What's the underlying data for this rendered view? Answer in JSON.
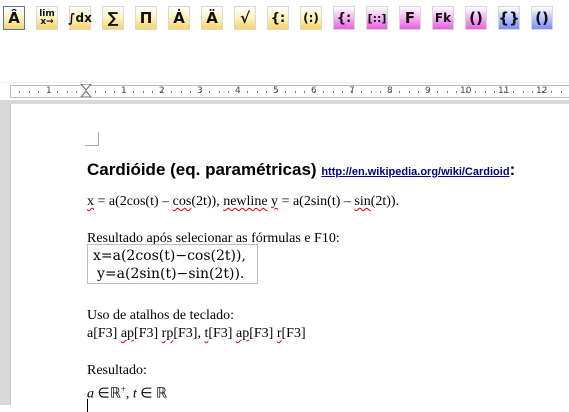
{
  "toolbar": {
    "buttons": [
      {
        "name": "symbol-a-hat-button",
        "glyph": "Â",
        "style": "yellow",
        "active": true
      },
      {
        "name": "limits-button",
        "glyph": "lim x→",
        "style": "yellow"
      },
      {
        "name": "integral-button",
        "glyph": "∫dx",
        "style": "yellow"
      },
      {
        "name": "sum-button",
        "glyph": "∑",
        "style": "yellow"
      },
      {
        "name": "product-button",
        "glyph": "Π",
        "style": "yellow"
      },
      {
        "name": "attribute-a-button",
        "glyph": "Ȧ",
        "style": "yellow"
      },
      {
        "name": "attribute-a-dots-button",
        "glyph": "Ä",
        "style": "yellow"
      },
      {
        "name": "root-button",
        "glyph": "√",
        "style": "yellow"
      },
      {
        "name": "brace-colon-button",
        "glyph": "{:",
        "style": "yellow"
      },
      {
        "name": "paren-colon-button",
        "glyph": "(:)",
        "style": "yellow"
      },
      {
        "name": "brace-pink-button",
        "glyph": "{:",
        "style": "pink"
      },
      {
        "name": "matrix-pink-button",
        "glyph": "[::]",
        "style": "pink"
      },
      {
        "name": "font-f-button",
        "glyph": "F",
        "style": "pink"
      },
      {
        "name": "font-fk-button",
        "glyph": "Fk",
        "style": "pink"
      },
      {
        "name": "parentheses-button",
        "glyph": "()",
        "style": "pink"
      },
      {
        "name": "braces-blue-button",
        "glyph": "{}",
        "style": "blue"
      },
      {
        "name": "paren-blue-button",
        "glyph": "()",
        "style": "blue"
      }
    ]
  },
  "ruler": {
    "labels": [
      "1",
      "1",
      "2",
      "3",
      "4",
      "5",
      "6",
      "7",
      "8",
      "9",
      "10",
      "11",
      "12"
    ]
  },
  "document": {
    "heading": "Cardióide (eq. paramétricas)",
    "heading_link": "http://en.wikipedia.org/wiki/Cardioid",
    "heading_colon": ":",
    "line1_a": "x",
    "line1_b": " = a(2cos(t) – ",
    "line1_c": "cos",
    "line1_d": "(2t)), ",
    "line1_e": "newline",
    "line1_f": " ",
    "line1_g": "y",
    "line1_h": " = a(2sin(t) – ",
    "line1_i": "sin",
    "line1_j": "(2t)).",
    "result_label": "Resultado após selecionar as fórmulas e F10:",
    "formula1": "x=a(2cos(t)−cos(2t)),",
    "formula2": "y=a(2sin(t)−sin(2t)).",
    "shortcut_label": "Uso de atalhos de teclado:",
    "sc_1": "a[F3] ",
    "sc_2": "ap",
    "sc_3": "[F3] ",
    "sc_4": "rp",
    "sc_5": "[F3], ",
    "sc_6": "t",
    "sc_7": "[F3] ",
    "sc_8": "ap",
    "sc_9": "[F3] ",
    "sc_10": "r",
    "sc_11": "[F3]",
    "result2_label": "Resultado:",
    "result2_a": "a",
    "result2_b": " ∈ℝ",
    "result2_sup": "+",
    "result2_c": ", ",
    "result2_d": "t",
    "result2_e": " ∈ ℝ"
  }
}
